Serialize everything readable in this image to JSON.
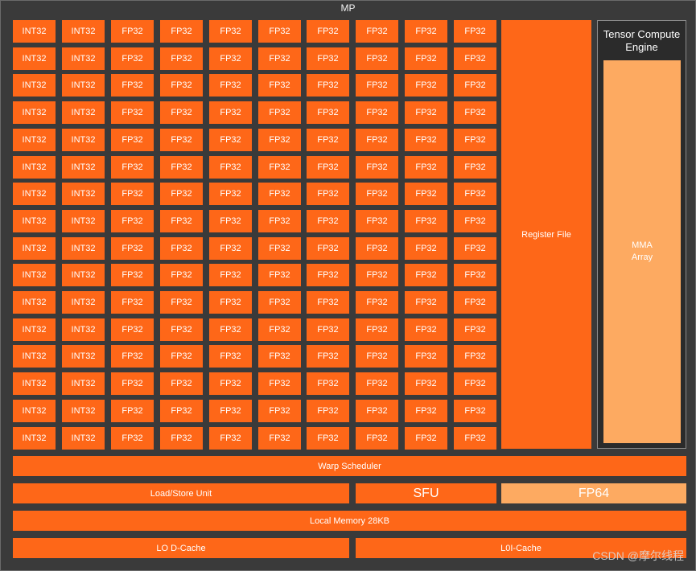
{
  "diagram": {
    "title": "MP",
    "core_grid": {
      "rows": 16,
      "columns": [
        "INT32",
        "INT32",
        "FP32",
        "FP32",
        "FP32",
        "FP32",
        "FP32",
        "FP32",
        "FP32",
        "FP32"
      ]
    },
    "register_file": "Register File",
    "tensor_engine": {
      "title": "Tensor Compute Engine",
      "array_label": "MMA Array"
    },
    "warp_scheduler": "Warp Scheduler",
    "load_store_unit": "Load/Store Unit",
    "sfu": "SFU",
    "fp64": "FP64",
    "local_memory": "Local Memory 28KB",
    "l0_dcache": "LO D-Cache",
    "l0_icache": "L0I-Cache"
  },
  "watermark": "CSDN @摩尔线程",
  "colors": {
    "unit_orange": "#fe6718",
    "light_orange": "#fdaa61",
    "background": "#3a3a3a"
  }
}
